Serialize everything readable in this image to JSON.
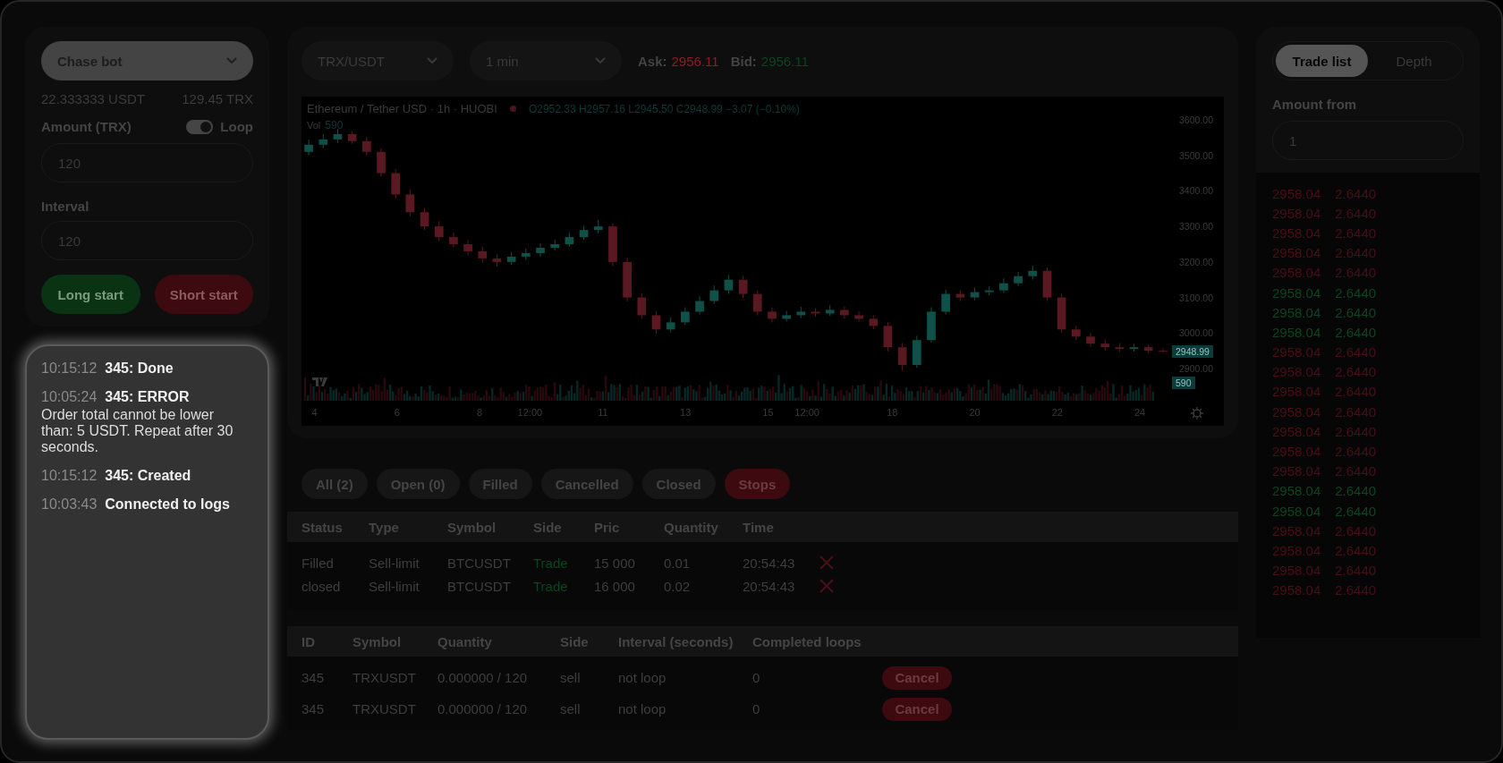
{
  "bot": {
    "mode": "Chase bot",
    "balance_usdt": "22.333333 USDT",
    "balance_trx": "129.45 TRX",
    "amount_label": "Amount (TRX)",
    "loop": {
      "label": "Loop",
      "on": true
    },
    "amount": "120",
    "interval_label": "Interval",
    "interval": "120",
    "long_button": "Long start",
    "short_button": "Short start"
  },
  "logs": [
    {
      "time": "10:15:12",
      "title": "345: Done"
    },
    {
      "time": "10:05:24",
      "title": "345: ERROR",
      "message": "Order total cannot be lower than: 5 USDT. Repeat after 30 seconds."
    },
    {
      "time": "10:15:12",
      "title": "345: Created"
    },
    {
      "time": "10:03:43",
      "title": "Connected to logs"
    }
  ],
  "market": {
    "pair": "TRX/USDT",
    "timeframe": "1 min",
    "ask_label": "Ask:",
    "ask": "2956.11",
    "bid_label": "Bid:",
    "bid": "2956.11"
  },
  "chart": {
    "title": "Ethereum / Tether USD · 1h · HUOBI",
    "ohlc": "O2952.33 H2957.16 L2945.50 C2948.99 −3.07 (−0.10%)",
    "vol_label": "Vol",
    "vol_value": "590",
    "price_tag": "2948.99",
    "vol_tag": "590",
    "x_labels": [
      "4",
      "6",
      "8",
      "12:00",
      "11",
      "13",
      "15",
      "12:00",
      "18",
      "20",
      "22",
      "24"
    ],
    "chart_data": {
      "type": "candlestick",
      "ylim": [
        2900,
        3600
      ],
      "yticks": [
        {
          "value": 3600,
          "label": "3600.00"
        },
        {
          "value": 3500,
          "label": "3500.00"
        },
        {
          "value": 3400,
          "label": "3400.00"
        },
        {
          "value": 3300,
          "label": "3300.00"
        },
        {
          "value": 3200,
          "label": "3200.00"
        },
        {
          "value": 3100,
          "label": "3100.00"
        },
        {
          "value": 3000,
          "label": "3000.00"
        },
        {
          "value": 2900,
          "label": "2900.00"
        }
      ],
      "categories": [
        null,
        null,
        null,
        null,
        null,
        null,
        null,
        null,
        null,
        null,
        null,
        null,
        null,
        null,
        null,
        null,
        null,
        null,
        null,
        null,
        null,
        null,
        null,
        null,
        null,
        null,
        null,
        null,
        null,
        null,
        null,
        null,
        null,
        null,
        null,
        null,
        null,
        null,
        null,
        null,
        null,
        null,
        null,
        null,
        null,
        null,
        null,
        null,
        null,
        null,
        null,
        null,
        null,
        null,
        null,
        null,
        null,
        null,
        null,
        null
      ],
      "ohlc": [
        [
          3510,
          3545,
          3500,
          3530
        ],
        [
          3530,
          3560,
          3520,
          3545
        ],
        [
          3545,
          3575,
          3535,
          3560
        ],
        [
          3560,
          3568,
          3532,
          3540
        ],
        [
          3540,
          3552,
          3498,
          3510
        ],
        [
          3510,
          3520,
          3440,
          3450
        ],
        [
          3450,
          3462,
          3378,
          3390
        ],
        [
          3390,
          3405,
          3328,
          3340
        ],
        [
          3340,
          3352,
          3290,
          3300
        ],
        [
          3300,
          3315,
          3258,
          3270
        ],
        [
          3270,
          3282,
          3240,
          3250
        ],
        [
          3250,
          3262,
          3218,
          3230
        ],
        [
          3230,
          3244,
          3198,
          3210
        ],
        [
          3210,
          3222,
          3188,
          3200
        ],
        [
          3200,
          3228,
          3192,
          3215
        ],
        [
          3215,
          3238,
          3205,
          3225
        ],
        [
          3225,
          3252,
          3214,
          3240
        ],
        [
          3240,
          3262,
          3232,
          3250
        ],
        [
          3250,
          3284,
          3243,
          3270
        ],
        [
          3270,
          3302,
          3262,
          3290
        ],
        [
          3290,
          3318,
          3280,
          3300
        ],
        [
          3300,
          3310,
          3188,
          3200
        ],
        [
          3200,
          3212,
          3088,
          3100
        ],
        [
          3100,
          3112,
          3040,
          3050
        ],
        [
          3050,
          3062,
          2998,
          3010
        ],
        [
          3010,
          3044,
          3002,
          3030
        ],
        [
          3030,
          3072,
          3022,
          3060
        ],
        [
          3060,
          3104,
          3052,
          3090
        ],
        [
          3090,
          3134,
          3082,
          3120
        ],
        [
          3120,
          3164,
          3110,
          3150
        ],
        [
          3150,
          3160,
          3098,
          3110
        ],
        [
          3110,
          3120,
          3050,
          3060
        ],
        [
          3060,
          3072,
          3030,
          3040
        ],
        [
          3040,
          3062,
          3032,
          3050
        ],
        [
          3050,
          3074,
          3042,
          3060
        ],
        [
          3060,
          3070,
          3046,
          3055
        ],
        [
          3055,
          3078,
          3048,
          3065
        ],
        [
          3065,
          3074,
          3040,
          3050
        ],
        [
          3050,
          3060,
          3032,
          3040
        ],
        [
          3040,
          3050,
          3010,
          3020
        ],
        [
          3020,
          3030,
          2948,
          2960
        ],
        [
          2960,
          2972,
          2895,
          2910
        ],
        [
          2910,
          2992,
          2902,
          2980
        ],
        [
          2980,
          3072,
          2972,
          3060
        ],
        [
          3060,
          3122,
          3052,
          3110
        ],
        [
          3110,
          3120,
          3090,
          3100
        ],
        [
          3100,
          3128,
          3092,
          3115
        ],
        [
          3115,
          3132,
          3106,
          3120
        ],
        [
          3120,
          3154,
          3112,
          3140
        ],
        [
          3140,
          3172,
          3132,
          3160
        ],
        [
          3160,
          3190,
          3150,
          3175
        ],
        [
          3175,
          3184,
          3090,
          3100
        ],
        [
          3100,
          3110,
          3000,
          3010
        ],
        [
          3010,
          3020,
          2980,
          2990
        ],
        [
          2990,
          3000,
          2962,
          2970
        ],
        [
          2970,
          2982,
          2950,
          2960
        ],
        [
          2960,
          2972,
          2946,
          2955
        ],
        [
          2955,
          2970,
          2948,
          2960
        ],
        [
          2960,
          2968,
          2942,
          2950
        ],
        [
          2950,
          2957,
          2945,
          2949
        ]
      ]
    }
  },
  "order_tabs": [
    {
      "label": "All (2)",
      "selected": false
    },
    {
      "label": "Open (0)",
      "selected": false
    },
    {
      "label": "Filled",
      "selected": false
    },
    {
      "label": "Cancelled",
      "selected": false
    },
    {
      "label": "Closed",
      "selected": false
    },
    {
      "label": "Stops",
      "selected": true
    }
  ],
  "orders": {
    "columns": [
      "Status",
      "Type",
      "Symbol",
      "Side",
      "Pric",
      "Quantity",
      "Time"
    ],
    "rows": [
      [
        "Filled",
        "Sell-limit",
        "BTCUSDT",
        "Trade",
        "15 000",
        "0.01",
        "20:54:43"
      ],
      [
        "closed",
        "Sell-limit",
        "BTCUSDT",
        "Trade",
        "16 000",
        "0.02",
        "20:54:43"
      ]
    ]
  },
  "bots": {
    "columns": [
      "ID",
      "Symbol",
      "Quantity",
      "Side",
      "Interval (seconds)",
      "Completed loops"
    ],
    "rows": [
      {
        "cells": [
          "345",
          "TRXUSDT",
          "0.000000 / 120",
          "sell",
          "not loop",
          "0"
        ],
        "action": "Cancel"
      },
      {
        "cells": [
          "345",
          "TRXUSDT",
          "0.000000 / 120",
          "sell",
          "not loop",
          "0"
        ],
        "action": "Cancel"
      }
    ]
  },
  "side_tabs": [
    {
      "label": "Trade list",
      "selected": true
    },
    {
      "label": "Depth",
      "selected": false
    }
  ],
  "amount_from": {
    "label": "Amount from",
    "value": "1"
  },
  "trades": [
    {
      "price": "2958.04",
      "amount": "2.6440",
      "color": "#4a0f16"
    },
    {
      "price": "2958.04",
      "amount": "2.6440",
      "color": "#4a0f16"
    },
    {
      "price": "2958.04",
      "amount": "2.6440",
      "color": "#4a0f16"
    },
    {
      "price": "2958.04",
      "amount": "2.6440",
      "color": "#4a0f16"
    },
    {
      "price": "2958.04",
      "amount": "2.6440",
      "color": "#4a0f16"
    },
    {
      "price": "2958.04",
      "amount": "2.6440",
      "color": "#0d4420"
    },
    {
      "price": "2958.04",
      "amount": "2.6440",
      "color": "#0d4420"
    },
    {
      "price": "2958.04",
      "amount": "2.6440",
      "color": "#0d4420"
    },
    {
      "price": "2958.04",
      "amount": "2.6440",
      "color": "#4a0f16"
    },
    {
      "price": "2958.04",
      "amount": "2.6440",
      "color": "#4a0f16"
    },
    {
      "price": "2958.04",
      "amount": "2.6440",
      "color": "#4a0f16"
    },
    {
      "price": "2958.04",
      "amount": "2.6440",
      "color": "#4a0f16"
    },
    {
      "price": "2958.04",
      "amount": "2.6440",
      "color": "#4a0f16"
    },
    {
      "price": "2958.04",
      "amount": "2.6440",
      "color": "#4a0f16"
    },
    {
      "price": "2958.04",
      "amount": "2.6440",
      "color": "#4a0f16"
    },
    {
      "price": "2958.04",
      "amount": "2.6440",
      "color": "#0d4420"
    },
    {
      "price": "2958.04",
      "amount": "2.6440",
      "color": "#0d4420"
    },
    {
      "price": "2958.04",
      "amount": "2.6440",
      "color": "#4a0f16"
    },
    {
      "price": "2958.04",
      "amount": "2.6440",
      "color": "#4a0f16"
    },
    {
      "price": "2958.04",
      "amount": "2.6440",
      "color": "#4a0f16"
    },
    {
      "price": "2958.04",
      "amount": "2.6440",
      "color": "#4a0f16"
    }
  ]
}
